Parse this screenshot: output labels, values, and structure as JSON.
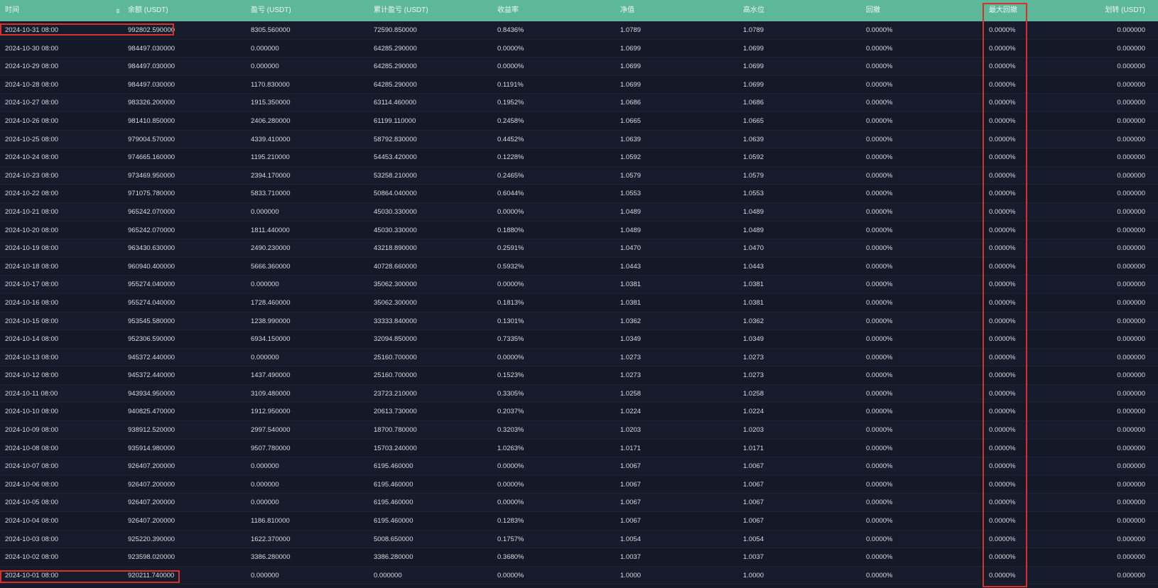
{
  "columns": [
    "时间",
    "余额 (USDT)",
    "盈亏 (USDT)",
    "累计盈亏 (USDT)",
    "收益率",
    "净值",
    "高水位",
    "回撤",
    "最大回撤",
    "划转 (USDT)"
  ],
  "rows": [
    [
      "2024-10-31 08:00",
      "992802.590000",
      "8305.560000",
      "72590.850000",
      "0.8436%",
      "1.0789",
      "1.0789",
      "0.0000%",
      "0.0000%",
      "0.000000"
    ],
    [
      "2024-10-30 08:00",
      "984497.030000",
      "0.000000",
      "64285.290000",
      "0.0000%",
      "1.0699",
      "1.0699",
      "0.0000%",
      "0.0000%",
      "0.000000"
    ],
    [
      "2024-10-29 08:00",
      "984497.030000",
      "0.000000",
      "64285.290000",
      "0.0000%",
      "1.0699",
      "1.0699",
      "0.0000%",
      "0.0000%",
      "0.000000"
    ],
    [
      "2024-10-28 08:00",
      "984497.030000",
      "1170.830000",
      "64285.290000",
      "0.1191%",
      "1.0699",
      "1.0699",
      "0.0000%",
      "0.0000%",
      "0.000000"
    ],
    [
      "2024-10-27 08:00",
      "983326.200000",
      "1915.350000",
      "63114.460000",
      "0.1952%",
      "1.0686",
      "1.0686",
      "0.0000%",
      "0.0000%",
      "0.000000"
    ],
    [
      "2024-10-26 08:00",
      "981410.850000",
      "2406.280000",
      "61199.110000",
      "0.2458%",
      "1.0665",
      "1.0665",
      "0.0000%",
      "0.0000%",
      "0.000000"
    ],
    [
      "2024-10-25 08:00",
      "979004.570000",
      "4339.410000",
      "58792.830000",
      "0.4452%",
      "1.0639",
      "1.0639",
      "0.0000%",
      "0.0000%",
      "0.000000"
    ],
    [
      "2024-10-24 08:00",
      "974665.160000",
      "1195.210000",
      "54453.420000",
      "0.1228%",
      "1.0592",
      "1.0592",
      "0.0000%",
      "0.0000%",
      "0.000000"
    ],
    [
      "2024-10-23 08:00",
      "973469.950000",
      "2394.170000",
      "53258.210000",
      "0.2465%",
      "1.0579",
      "1.0579",
      "0.0000%",
      "0.0000%",
      "0.000000"
    ],
    [
      "2024-10-22 08:00",
      "971075.780000",
      "5833.710000",
      "50864.040000",
      "0.6044%",
      "1.0553",
      "1.0553",
      "0.0000%",
      "0.0000%",
      "0.000000"
    ],
    [
      "2024-10-21 08:00",
      "965242.070000",
      "0.000000",
      "45030.330000",
      "0.0000%",
      "1.0489",
      "1.0489",
      "0.0000%",
      "0.0000%",
      "0.000000"
    ],
    [
      "2024-10-20 08:00",
      "965242.070000",
      "1811.440000",
      "45030.330000",
      "0.1880%",
      "1.0489",
      "1.0489",
      "0.0000%",
      "0.0000%",
      "0.000000"
    ],
    [
      "2024-10-19 08:00",
      "963430.630000",
      "2490.230000",
      "43218.890000",
      "0.2591%",
      "1.0470",
      "1.0470",
      "0.0000%",
      "0.0000%",
      "0.000000"
    ],
    [
      "2024-10-18 08:00",
      "960940.400000",
      "5666.360000",
      "40728.660000",
      "0.5932%",
      "1.0443",
      "1.0443",
      "0.0000%",
      "0.0000%",
      "0.000000"
    ],
    [
      "2024-10-17 08:00",
      "955274.040000",
      "0.000000",
      "35062.300000",
      "0.0000%",
      "1.0381",
      "1.0381",
      "0.0000%",
      "0.0000%",
      "0.000000"
    ],
    [
      "2024-10-16 08:00",
      "955274.040000",
      "1728.460000",
      "35062.300000",
      "0.1813%",
      "1.0381",
      "1.0381",
      "0.0000%",
      "0.0000%",
      "0.000000"
    ],
    [
      "2024-10-15 08:00",
      "953545.580000",
      "1238.990000",
      "33333.840000",
      "0.1301%",
      "1.0362",
      "1.0362",
      "0.0000%",
      "0.0000%",
      "0.000000"
    ],
    [
      "2024-10-14 08:00",
      "952306.590000",
      "6934.150000",
      "32094.850000",
      "0.7335%",
      "1.0349",
      "1.0349",
      "0.0000%",
      "0.0000%",
      "0.000000"
    ],
    [
      "2024-10-13 08:00",
      "945372.440000",
      "0.000000",
      "25160.700000",
      "0.0000%",
      "1.0273",
      "1.0273",
      "0.0000%",
      "0.0000%",
      "0.000000"
    ],
    [
      "2024-10-12 08:00",
      "945372.440000",
      "1437.490000",
      "25160.700000",
      "0.1523%",
      "1.0273",
      "1.0273",
      "0.0000%",
      "0.0000%",
      "0.000000"
    ],
    [
      "2024-10-11 08:00",
      "943934.950000",
      "3109.480000",
      "23723.210000",
      "0.3305%",
      "1.0258",
      "1.0258",
      "0.0000%",
      "0.0000%",
      "0.000000"
    ],
    [
      "2024-10-10 08:00",
      "940825.470000",
      "1912.950000",
      "20613.730000",
      "0.2037%",
      "1.0224",
      "1.0224",
      "0.0000%",
      "0.0000%",
      "0.000000"
    ],
    [
      "2024-10-09 08:00",
      "938912.520000",
      "2997.540000",
      "18700.780000",
      "0.3203%",
      "1.0203",
      "1.0203",
      "0.0000%",
      "0.0000%",
      "0.000000"
    ],
    [
      "2024-10-08 08:00",
      "935914.980000",
      "9507.780000",
      "15703.240000",
      "1.0263%",
      "1.0171",
      "1.0171",
      "0.0000%",
      "0.0000%",
      "0.000000"
    ],
    [
      "2024-10-07 08:00",
      "926407.200000",
      "0.000000",
      "6195.460000",
      "0.0000%",
      "1.0067",
      "1.0067",
      "0.0000%",
      "0.0000%",
      "0.000000"
    ],
    [
      "2024-10-06 08:00",
      "926407.200000",
      "0.000000",
      "6195.460000",
      "0.0000%",
      "1.0067",
      "1.0067",
      "0.0000%",
      "0.0000%",
      "0.000000"
    ],
    [
      "2024-10-05 08:00",
      "926407.200000",
      "0.000000",
      "6195.460000",
      "0.0000%",
      "1.0067",
      "1.0067",
      "0.0000%",
      "0.0000%",
      "0.000000"
    ],
    [
      "2024-10-04 08:00",
      "926407.200000",
      "1186.810000",
      "6195.460000",
      "0.1283%",
      "1.0067",
      "1.0067",
      "0.0000%",
      "0.0000%",
      "0.000000"
    ],
    [
      "2024-10-03 08:00",
      "925220.390000",
      "1622.370000",
      "5008.650000",
      "0.1757%",
      "1.0054",
      "1.0054",
      "0.0000%",
      "0.0000%",
      "0.000000"
    ],
    [
      "2024-10-02 08:00",
      "923598.020000",
      "3386.280000",
      "3386.280000",
      "0.3680%",
      "1.0037",
      "1.0037",
      "0.0000%",
      "0.0000%",
      "0.000000"
    ],
    [
      "2024-10-01 08:00",
      "920211.740000",
      "0.000000",
      "0.000000",
      "0.0000%",
      "1.0000",
      "1.0000",
      "0.0000%",
      "0.0000%",
      "0.000000"
    ]
  ],
  "colors": {
    "header_bg": "#5db89a",
    "body_bg": "#141a28",
    "highlight": "#d9302b"
  }
}
